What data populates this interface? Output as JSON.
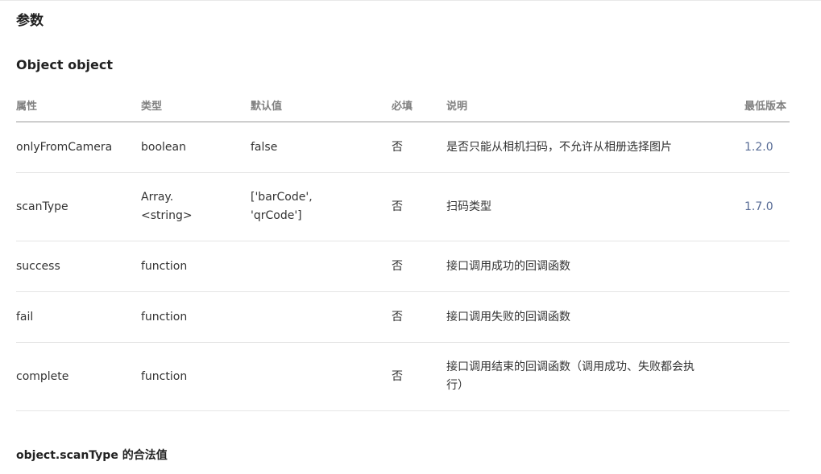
{
  "section_title": "参数",
  "param_heading": "Object object",
  "table": {
    "headers": {
      "name": "属性",
      "type": "类型",
      "default": "默认值",
      "required": "必填",
      "description": "说明",
      "version": "最低版本"
    },
    "rows": [
      {
        "name": "onlyFromCamera",
        "type": "boolean",
        "default": "false",
        "required": "否",
        "description": "是否只能从相机扫码，不允许从相册选择图片",
        "version": "1.2.0"
      },
      {
        "name": "scanType",
        "type": "Array.<string>",
        "default": "['barCode', 'qrCode']",
        "required": "否",
        "description": "扫码类型",
        "version": "1.7.0"
      },
      {
        "name": "success",
        "type": "function",
        "default": "",
        "required": "否",
        "description": "接口调用成功的回调函数",
        "version": ""
      },
      {
        "name": "fail",
        "type": "function",
        "default": "",
        "required": "否",
        "description": "接口调用失败的回调函数",
        "version": ""
      },
      {
        "name": "complete",
        "type": "function",
        "default": "",
        "required": "否",
        "description": "接口调用结束的回调函数（调用成功、失败都会执行）",
        "version": ""
      }
    ]
  },
  "subsection_heading": "object.scanType 的合法值",
  "colors": {
    "text": "#333333",
    "header_text": "#808080",
    "version_link": "#576b95"
  }
}
